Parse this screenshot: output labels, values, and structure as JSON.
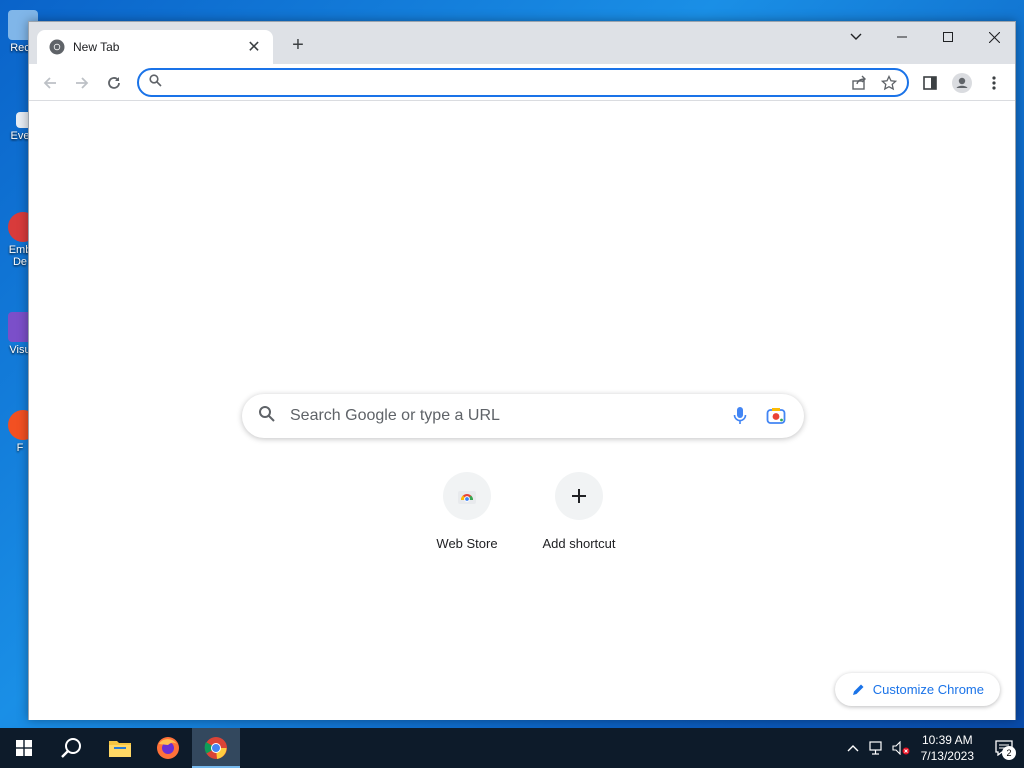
{
  "desktop": {
    "icons": [
      {
        "label": "Rec",
        "color": "#9ecbf0"
      },
      {
        "label": "Eve",
        "color": "#ffffff"
      },
      {
        "label": "Emb",
        "label2": "De",
        "color": "#d83b3b"
      },
      {
        "label": "Visu",
        "color": "#7b4fc9"
      },
      {
        "label": "F",
        "color": "#f25022"
      }
    ]
  },
  "browser": {
    "tab": {
      "title": "New Tab",
      "favicon": "chrome-icon"
    },
    "new_tab_symbol": "+",
    "window_controls": {
      "tab_search": "chevron-down-icon",
      "minimize": "minimize-icon",
      "maximize": "maximize-icon",
      "close": "close-icon"
    },
    "omnibox": {
      "value": "",
      "placeholder": ""
    },
    "accent": "#1a73e8"
  },
  "ntp": {
    "search_placeholder": "Search Google or type a URL",
    "shortcuts": [
      {
        "label": "Web Store",
        "icon": "web-store-icon"
      },
      {
        "label": "Add shortcut",
        "icon": "plus-icon"
      }
    ],
    "customize_label": "Customize Chrome"
  },
  "taskbar": {
    "apps": [
      "windows-start-icon",
      "search-icon",
      "file-explorer-icon",
      "firefox-icon",
      "chrome-icon"
    ],
    "time": "10:39 AM",
    "date": "7/13/2023",
    "notification_count": "2"
  }
}
